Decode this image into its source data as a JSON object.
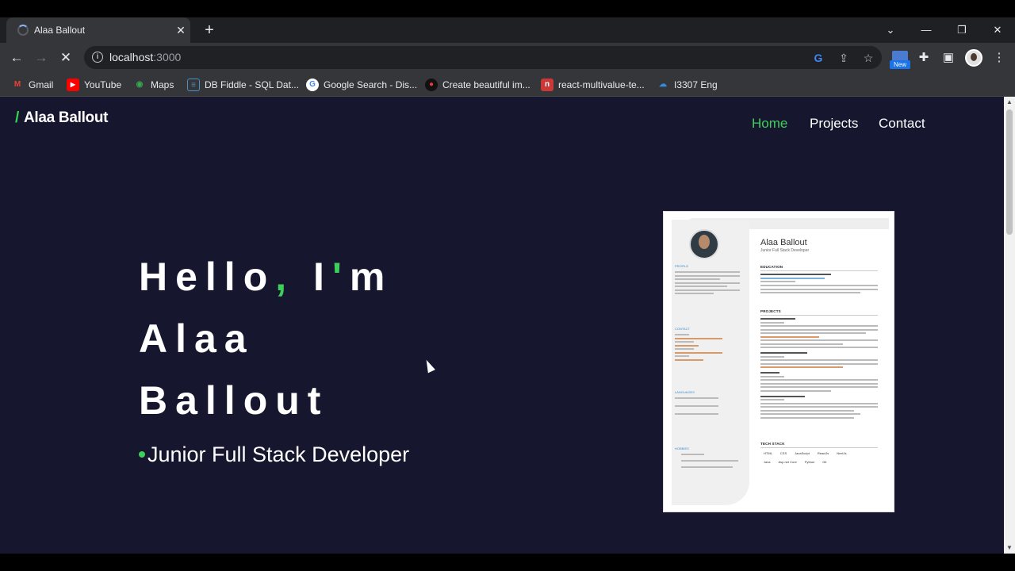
{
  "browser": {
    "tab_title": "Alaa Ballout",
    "url_host": "localhost",
    "url_port": ":3000",
    "window_controls": [
      "chevron-down-icon",
      "minimize-icon",
      "restore-icon",
      "close-icon"
    ],
    "extension_badge": "New",
    "bookmarks": [
      {
        "label": "Gmail",
        "icon": "gmail-icon",
        "color": "#ea4335"
      },
      {
        "label": "YouTube",
        "icon": "youtube-icon",
        "color": "#ff0000"
      },
      {
        "label": "Maps",
        "icon": "maps-icon",
        "color": "#34a853"
      },
      {
        "label": "DB Fiddle - SQL Dat...",
        "icon": "db-icon",
        "color": "#4a90c2"
      },
      {
        "label": "Google Search - Dis...",
        "icon": "google-icon",
        "color": "#4285f4"
      },
      {
        "label": "Create beautiful im...",
        "icon": "carbon-icon",
        "color": "#e53935"
      },
      {
        "label": "react-multivalue-te...",
        "icon": "npm-icon",
        "color": "#cb3837"
      },
      {
        "label": "I3307 Eng",
        "icon": "onedrive-icon",
        "color": "#2f8fdd"
      }
    ]
  },
  "site": {
    "logo_slash": "/",
    "logo_text": "Alaa Ballout",
    "nav": [
      {
        "label": "Home",
        "active": true
      },
      {
        "label": "Projects",
        "active": false
      },
      {
        "label": "Contact",
        "active": false
      }
    ],
    "hero": {
      "line1_a": "Hello",
      "line1_comma": ",",
      "line1_b": " I",
      "line1_apos": "'",
      "line1_c": "m",
      "line2": "Alaa",
      "line3": "Ballout",
      "role": "Junior Full Stack Developer"
    },
    "cv": {
      "name": "Alaa Ballout",
      "subtitle": "Junior Full Stack Developer",
      "left_sections": [
        "PROFILE",
        "CONTACT",
        "LANGUAGES",
        "HOBBIES"
      ],
      "right_sections": [
        "EDUCATION",
        "PROJECTS",
        "TECH STACK"
      ],
      "education_title": "Bachelor's degree of Computer Science",
      "projects": [
        "My Portfolio Website",
        "Science Scientific magazine",
        "CV Builder",
        "Task Tracker App - Rest API"
      ],
      "languages": [
        "English",
        "French",
        "Arabic"
      ],
      "tech_stack_row1": [
        "HTML",
        "CSS",
        "JavaScript",
        "ReactJs",
        "NextJs"
      ],
      "tech_stack_row2": [
        "Java",
        "Asp.net Core",
        "Python",
        "Git"
      ]
    }
  },
  "colors": {
    "accent_green": "#3ecf5a",
    "page_bg": "#16162f"
  }
}
